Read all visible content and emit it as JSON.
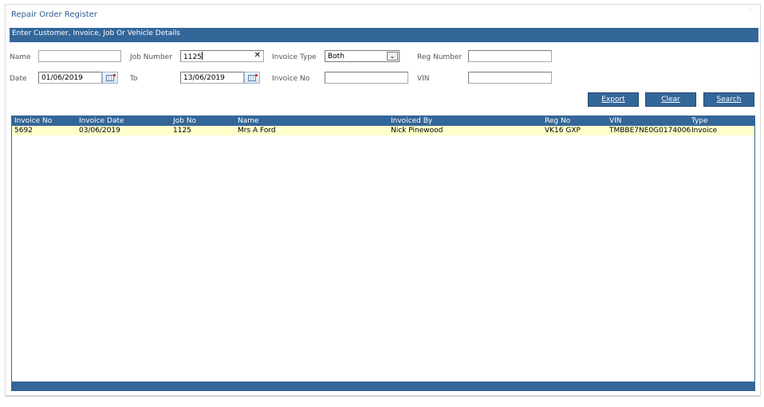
{
  "window": {
    "title": "Repair Order Register"
  },
  "filters": {
    "header": "Enter Customer, Invoice, Job Or Vehicle Details",
    "name_label": "Name",
    "name_value": "",
    "job_number_label": "Job Number",
    "job_number_value": "1125",
    "invoice_type_label": "Invoice Type",
    "invoice_type_value": "Both",
    "reg_number_label": "Reg Number",
    "reg_number_value": "",
    "date_label": "Date",
    "date_from_value": "01/06/2019",
    "to_label": "To",
    "date_to_value": "13/06/2019",
    "invoice_no_label": "Invoice No",
    "invoice_no_value": "",
    "vin_label": "VIN",
    "vin_value": ""
  },
  "buttons": {
    "export": "Export",
    "clear": "Clear",
    "search": "Search"
  },
  "grid": {
    "columns": [
      "Invoice No",
      "Invoice Date",
      "Job No",
      "Name",
      "Invoiced By",
      "Reg No",
      "VIN",
      "Type"
    ],
    "rows": [
      [
        "5692",
        "03/06/2019",
        "1125",
        "Mrs A Ford",
        "Nick Pinewood",
        "VK16 GXP",
        "TMBBE7NE0G0174006",
        "Invoice"
      ]
    ]
  },
  "colors": {
    "accent": "#336699",
    "selected_row": "#ffffcc",
    "title": "#2d5a8c"
  }
}
